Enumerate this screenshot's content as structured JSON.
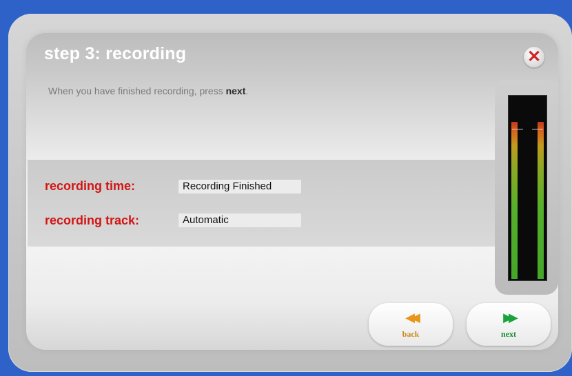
{
  "dialog": {
    "title": "step 3: recording",
    "instruction_prefix": "When you have finished recording, press ",
    "instruction_emphasis": "next",
    "instruction_suffix": ".",
    "close_icon": "close-icon"
  },
  "fields": {
    "time_label": "recording time:",
    "time_value": "Recording Finished",
    "track_label": "recording track:",
    "track_value": "Automatic"
  },
  "meter": {
    "left_level": 0.87,
    "right_level": 0.87
  },
  "buttons": {
    "back_label": "back",
    "back_icon": "rewind-icon",
    "next_label": "next",
    "next_icon": "fast-forward-icon"
  },
  "colors": {
    "accent_red": "#d21515",
    "back_icon_color": "#e8951c",
    "next_icon_color": "#1aa33a",
    "background": "#2f62c8"
  }
}
